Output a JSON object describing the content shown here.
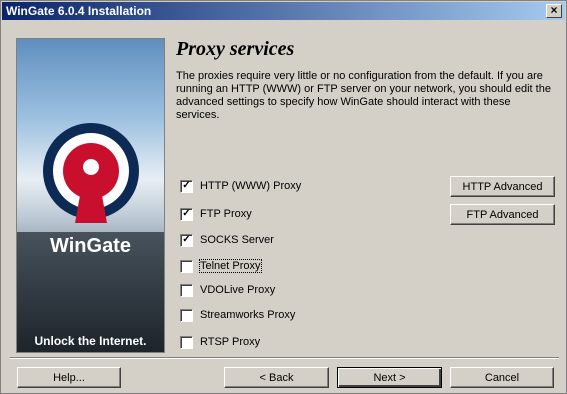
{
  "window": {
    "title": "WinGate 6.0.4 Installation",
    "close_glyph": "×"
  },
  "banner": {
    "brand": "WinGate",
    "tagline": "Unlock the Internet."
  },
  "page": {
    "heading": "Proxy services",
    "description": "The proxies require very little or no configuration from the default. If you are running an HTTP (WWW) or FTP server on your network, you should edit the advanced settings to specify how WinGate should interact with these services."
  },
  "checkboxes": [
    {
      "label": "HTTP (WWW) Proxy",
      "checked": true
    },
    {
      "label": "FTP Proxy",
      "checked": true
    },
    {
      "label": "SOCKS Server",
      "checked": true
    },
    {
      "label": "Telnet Proxy",
      "checked": false
    },
    {
      "label": "VDOLive Proxy",
      "checked": false
    },
    {
      "label": "Streamworks Proxy",
      "checked": false
    },
    {
      "label": "RTSP Proxy",
      "checked": false
    }
  ],
  "advanced_buttons": {
    "http": "HTTP Advanced",
    "ftp": "FTP Advanced"
  },
  "footer": {
    "help": "Help...",
    "back": "< Back",
    "next": "Next >",
    "cancel": "Cancel"
  }
}
